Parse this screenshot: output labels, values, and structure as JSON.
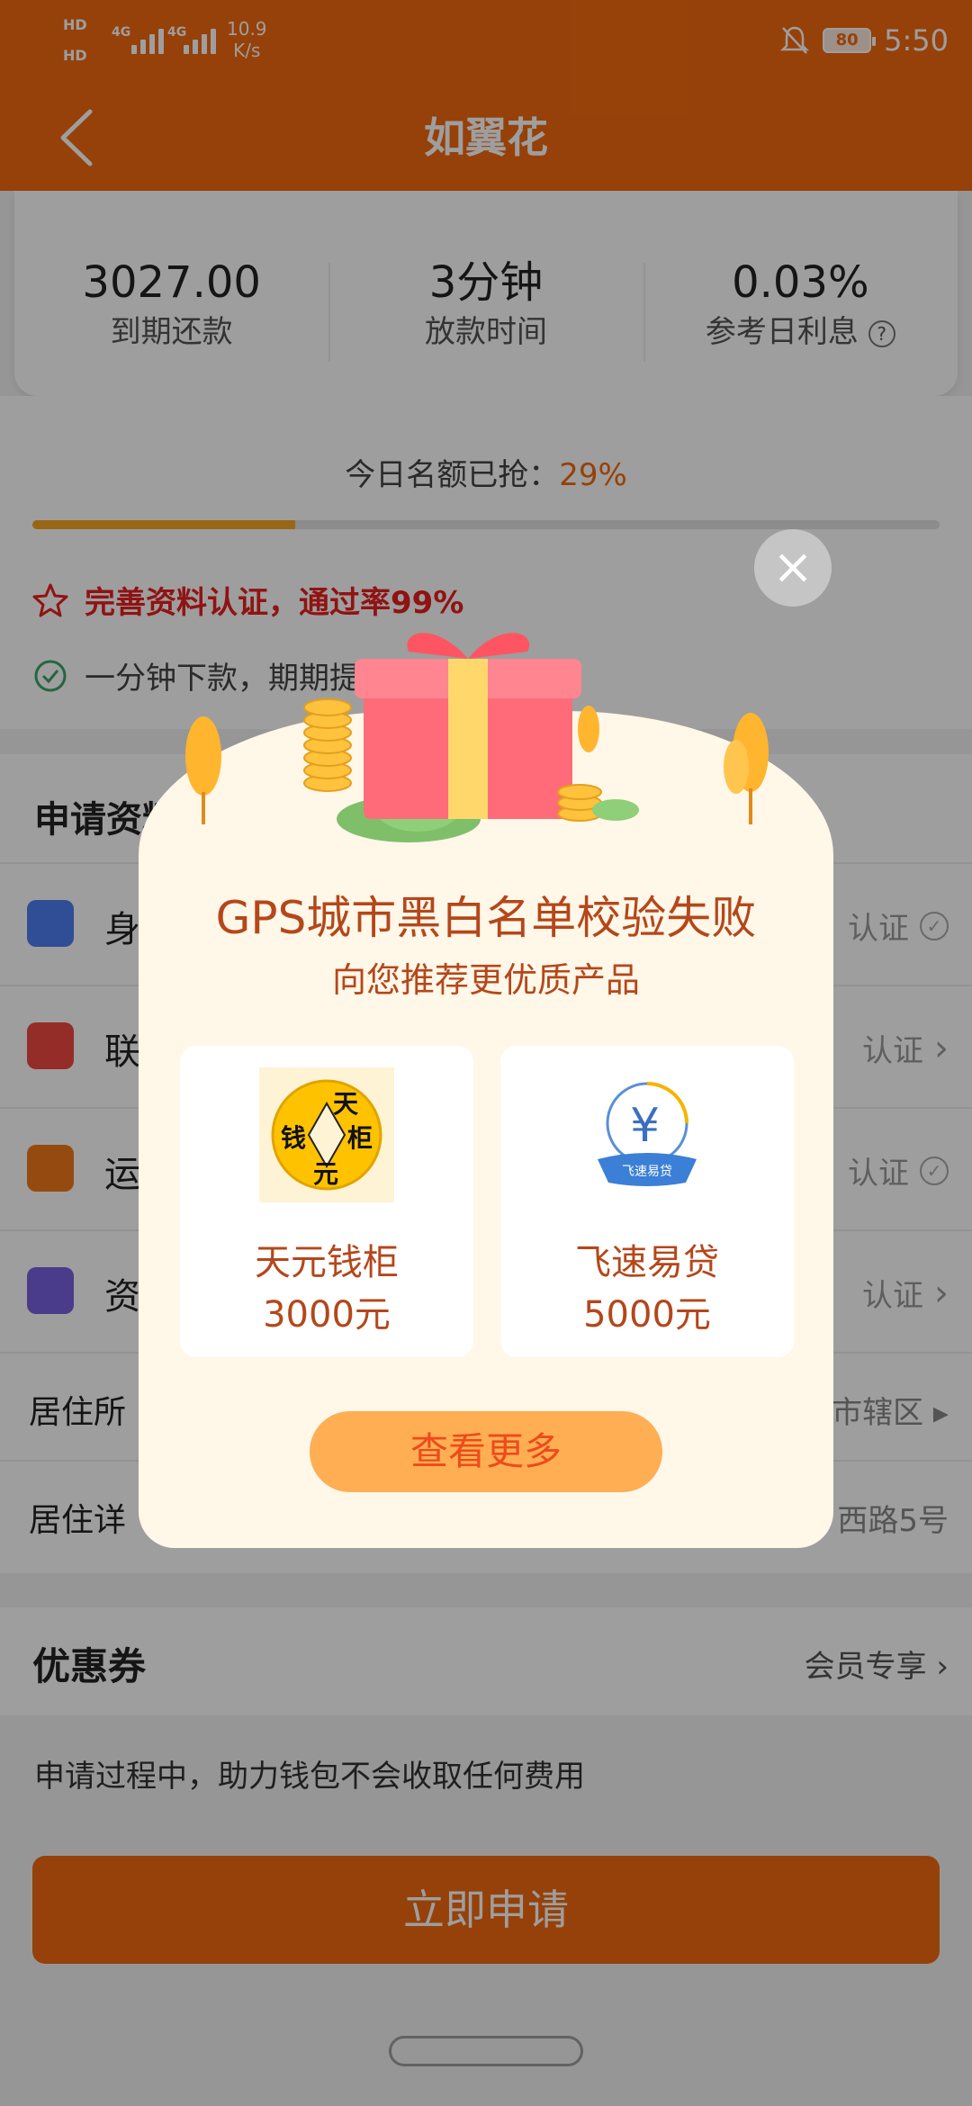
{
  "status_bar": {
    "sim1": "HD",
    "sim2": "HD",
    "net1": "4G",
    "net2": "4G",
    "speed_value": "10.9",
    "speed_unit": "K/s",
    "battery": "80",
    "time": "5:50"
  },
  "header": {
    "title": "如翼花"
  },
  "stats": [
    {
      "value": "3027.00",
      "label": "到期还款"
    },
    {
      "value": "3分钟",
      "label": "放款时间"
    },
    {
      "value": "0.03%",
      "label": "参考日利息"
    }
  ],
  "quota": {
    "label": "今日名额已抢：",
    "percent": "29%",
    "progress": 0.29
  },
  "tips": {
    "tip1": "完善资料认证，通过率99%",
    "tip2": "一分钟下款，期期提"
  },
  "form": {
    "title": "申请资料",
    "rows": [
      {
        "label": "身",
        "status": "认证"
      },
      {
        "label": "联",
        "status": "认证"
      },
      {
        "label": "运",
        "status": "认证"
      },
      {
        "label": "资",
        "status": "认证"
      }
    ],
    "residence": {
      "label": "居住所",
      "value": "市辖区"
    },
    "address": {
      "label": "居住详",
      "value": "西路5号"
    }
  },
  "coupon": {
    "label": "优惠券",
    "right": "会员专享"
  },
  "notice": "申请过程中，助力钱包不会收取任何费用",
  "apply_button": "立即申请",
  "modal": {
    "headline": "GPS城市黑白名单校验失败",
    "subline": "向您推荐更优质产品",
    "products": [
      {
        "name": "天元钱柜",
        "amount": "3000元",
        "logo_text": [
          "天",
          "钱",
          "柜",
          "元"
        ]
      },
      {
        "name": "飞速易贷",
        "amount": "5000元",
        "logo_text": "飞速易贷"
      }
    ],
    "more_button": "查看更多",
    "close_icon": "×"
  },
  "colors": {
    "brand": "#f26a0f",
    "modal_text": "#b4471b",
    "tip_red": "#e8201f"
  }
}
